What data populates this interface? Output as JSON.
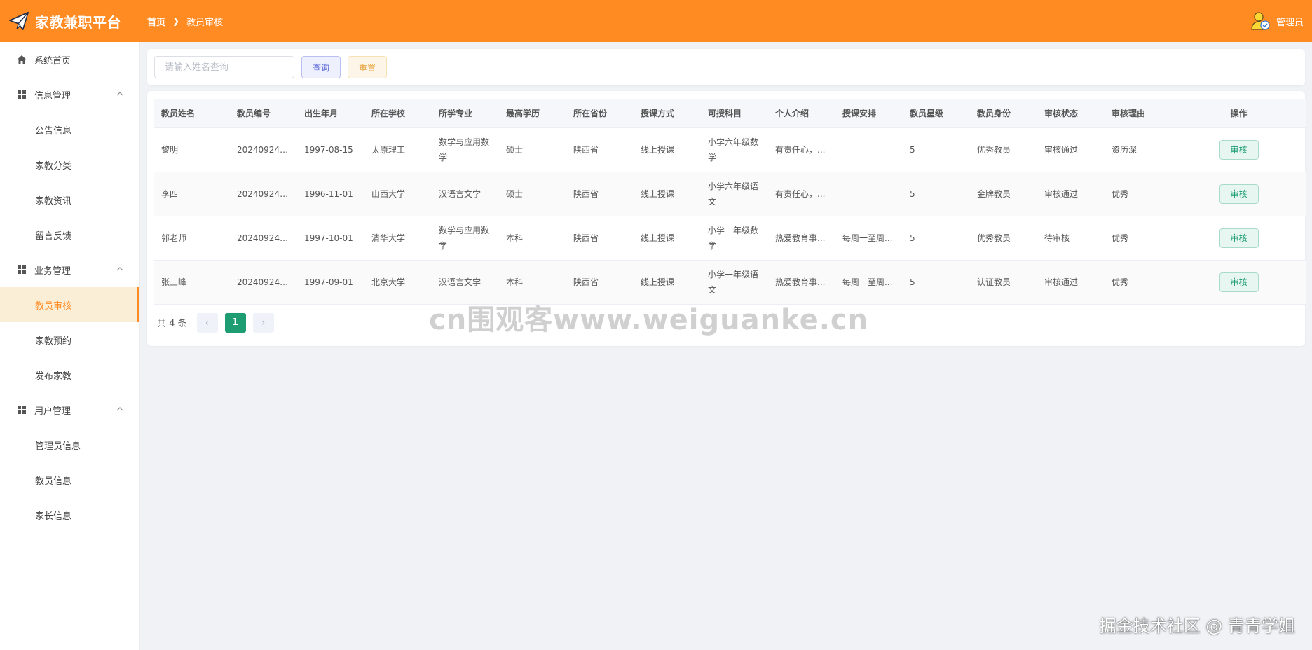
{
  "app": {
    "title": "家教兼职平台"
  },
  "breadcrumb": {
    "home": "首页",
    "current": "教员审核"
  },
  "user": {
    "name": "管理员"
  },
  "sidebar": {
    "items": [
      {
        "label": "系统首页",
        "icon": "home-icon"
      },
      {
        "label": "信息管理",
        "icon": "grid-icon",
        "children": [
          "公告信息",
          "家教分类",
          "家教资讯",
          "留言反馈"
        ]
      },
      {
        "label": "业务管理",
        "icon": "grid-icon",
        "children": [
          "教员审核",
          "家教预约",
          "发布家教"
        ]
      },
      {
        "label": "用户管理",
        "icon": "grid-icon",
        "children": [
          "管理员信息",
          "教员信息",
          "家长信息"
        ]
      }
    ],
    "active": "教员审核"
  },
  "search": {
    "placeholder": "请输入姓名查询",
    "value": "",
    "query_label": "查询",
    "reset_label": "重置"
  },
  "table": {
    "columns": [
      "教员姓名",
      "教员编号",
      "出生年月",
      "所在学校",
      "所学专业",
      "最高学历",
      "所在省份",
      "授课方式",
      "可授科目",
      "个人介绍",
      "授课安排",
      "教员星级",
      "教员身份",
      "审核状态",
      "审核理由",
      "操作"
    ],
    "rows": [
      [
        "黎明",
        "2024092411...",
        "1997-08-15",
        "太原理工",
        "数学与应用数学",
        "硕士",
        "陕西省",
        "线上授课",
        "小学六年级数学",
        "有责任心，...",
        "",
        "5",
        "优秀教员",
        "审核通过",
        "资历深"
      ],
      [
        "李四",
        "2024092411...",
        "1996-11-01",
        "山西大学",
        "汉语言文学",
        "硕士",
        "陕西省",
        "线上授课",
        "小学六年级语文",
        "有责任心，...",
        "",
        "5",
        "金牌教员",
        "审核通过",
        "优秀"
      ],
      [
        "郭老师",
        "2024092400...",
        "1997-10-01",
        "清华大学",
        "数学与应用数学",
        "本科",
        "陕西省",
        "线上授课",
        "小学一年级数学",
        "热爱教育事...",
        "每周一至周...",
        "5",
        "优秀教员",
        "待审核",
        "优秀"
      ],
      [
        "张三峰",
        "2024092400...",
        "1997-09-01",
        "北京大学",
        "汉语言文学",
        "本科",
        "陕西省",
        "线上授课",
        "小学一年级语文",
        "热爱教育事...",
        "每周一至周...",
        "5",
        "认证教员",
        "审核通过",
        "优秀"
      ]
    ],
    "action_label": "审核"
  },
  "pagination": {
    "total": "共 4 条",
    "current": "1"
  },
  "watermarks": {
    "center": "cn围观客www.weiguanke.cn",
    "corner": "掘金技术社区 @ 青青学姐"
  },
  "colors": {
    "accent": "#ff8b22",
    "active_bg": "#fbeed7",
    "success": "#1f9d72",
    "query": "#5b66d6",
    "reset": "#e6a23c"
  }
}
